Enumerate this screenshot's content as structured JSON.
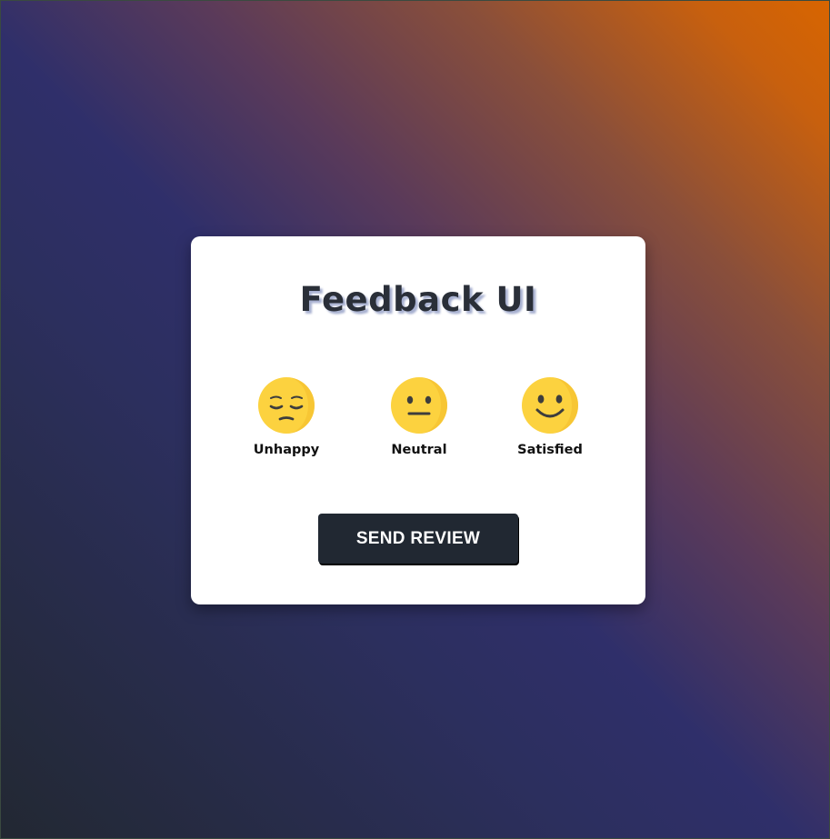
{
  "card": {
    "title": "Feedback UI",
    "ratings": [
      {
        "label": "Unhappy",
        "icon": "pensive-face-icon"
      },
      {
        "label": "Neutral",
        "icon": "neutral-face-icon"
      },
      {
        "label": "Satisfied",
        "icon": "slightly-smiling-face-icon"
      }
    ],
    "send_label": "SEND REVIEW"
  },
  "colors": {
    "card_background": "#ffffff",
    "button_background": "#212832",
    "title_text": "#2a2f38",
    "emoji_yellow": "#fcd23f",
    "gradient_start": "#222832",
    "gradient_mid": "#2f2f6a",
    "gradient_end": "#d86500"
  }
}
